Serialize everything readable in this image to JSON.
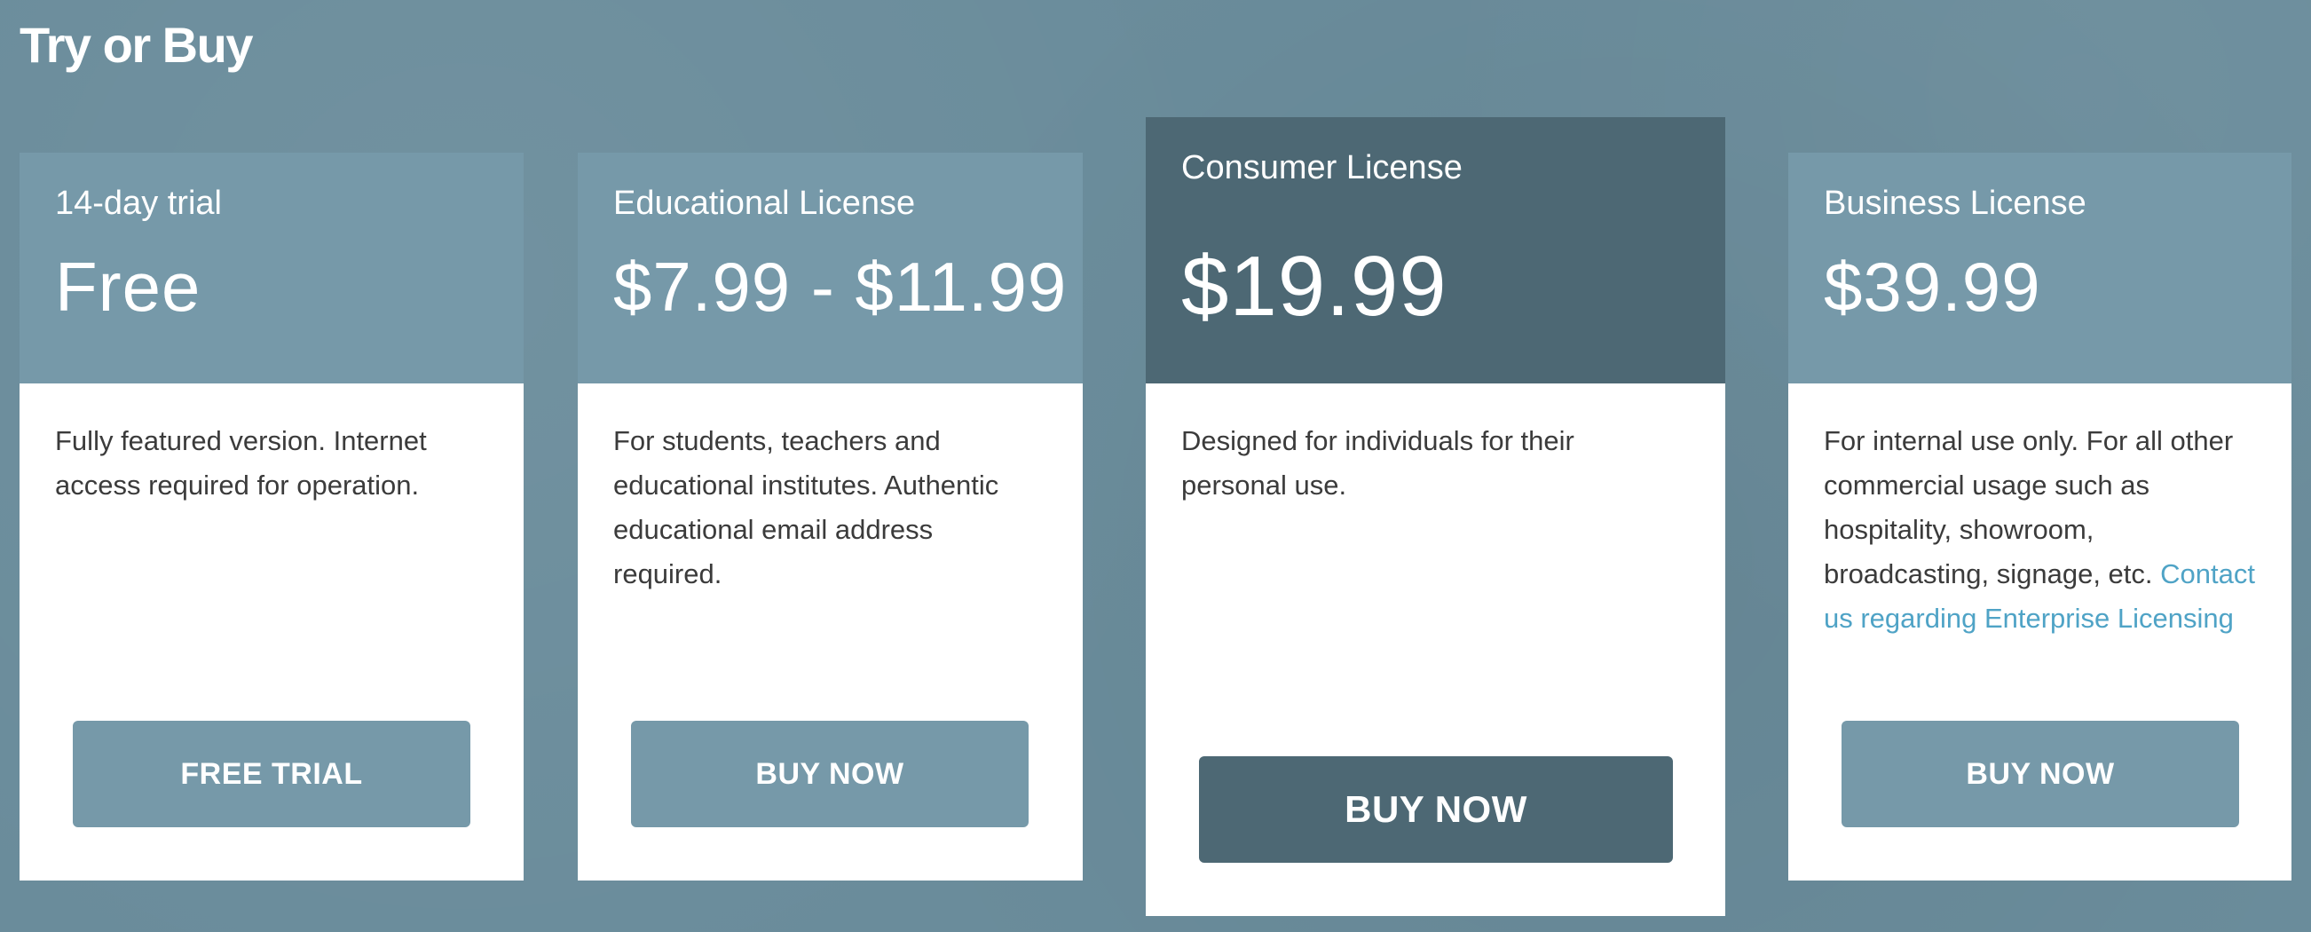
{
  "page": {
    "title": "Try or Buy"
  },
  "plans": [
    {
      "name": "14-day trial",
      "price": "Free",
      "description": "Fully featured version. Internet access required for operation.",
      "button_label": "FREE TRIAL"
    },
    {
      "name": "Educational License",
      "price": "$7.99 - $11.99",
      "description": "For students, teachers and educational institutes. Authentic educational email address required.",
      "button_label": "BUY NOW"
    },
    {
      "name": "Consumer License",
      "price": "$19.99",
      "description": "Designed for individuals for their personal use.",
      "button_label": "BUY NOW",
      "highlighted": true
    },
    {
      "name": "Business License",
      "price": "$39.99",
      "description": "For internal use only. For all other commercial usage such as hospitality, showroom, broadcasting, signage, etc.",
      "link_text": "Contact us regarding Enterprise Licensing",
      "button_label": "BUY NOW"
    }
  ],
  "colors": {
    "background": "#6a8c9b",
    "card_header": "#7699a9",
    "featured_header": "#4d6874",
    "link": "#4fa3c6",
    "body_text": "#3b3b3b"
  }
}
